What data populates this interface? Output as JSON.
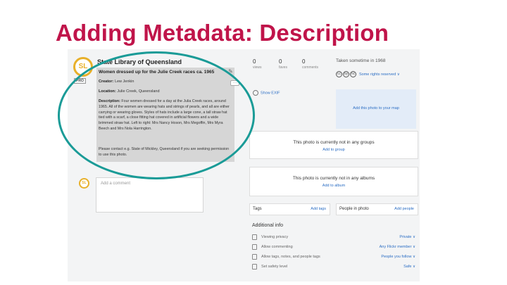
{
  "slide": {
    "title": "Adding Metadata: Description"
  },
  "owner": {
    "avatar_initials": "SL",
    "pro_badge": "PRO",
    "name": "State Library of Queensland"
  },
  "photo": {
    "title": "Women dressed up for the Julie Creek races ca. 1965",
    "creator_label": "Creator:",
    "creator_value": "Lew Jenkin",
    "location_label": "Location:",
    "location_value": "Julie Creek, Queensland",
    "description_label": "Description:",
    "description_text": "Four women dressed for a day at the Julia Creek races, around 1965. All of the women are wearing hats and strings of pearls, and all are either carrying or wearing gloves. Styles of hats include a large cone, a tall straw hat tied with a scarf, a close fitting hat covered in artificial flowers and a wide brimmed straw hat. Left to right: Mrs Nancy Hoson, Mrs Megoffin, Mrs Myra Beech and Mrs Nola Harrington.",
    "contact_text": "Please contact e.g. State of Mickley, Queensland if you are seeking permission to use this photo."
  },
  "comments": {
    "avatar_initials": "SL",
    "placeholder": "Add a comment"
  },
  "stats": [
    {
      "value": "0",
      "label": "views"
    },
    {
      "value": "0",
      "label": "faves"
    },
    {
      "value": "0",
      "label": "comments"
    }
  ],
  "taken": "Taken sometime in 1968",
  "license": {
    "icons": [
      "cc",
      "by",
      "nc"
    ],
    "rights_label": "Some rights reserved ∨"
  },
  "exif": {
    "label": "Show EXIF"
  },
  "map": {
    "label": "Add this photo to your map"
  },
  "groups": {
    "text": "This photo is currently not in any groups",
    "action": "Add to group"
  },
  "albums": {
    "text": "This photo is currently not in any albums",
    "action": "Add to album"
  },
  "tags": {
    "label": "Tags",
    "action": "Add tags"
  },
  "people": {
    "label": "People in photo",
    "action": "Add people"
  },
  "additional_info": {
    "heading": "Additional info",
    "rows": [
      {
        "label": "Viewing privacy",
        "value": "Private ∨"
      },
      {
        "label": "Allow commenting",
        "value": "Any Flickr member ∨"
      },
      {
        "label": "Allow tags, notes, and people tags",
        "value": "People you follow ∨"
      },
      {
        "label": "Set safety level",
        "value": "Safe ∨"
      }
    ]
  },
  "colors": {
    "title": "#c0144a",
    "highlight_ellipse": "#1a9b97",
    "link": "#2c6ec4",
    "avatar": "#e8b02a"
  }
}
